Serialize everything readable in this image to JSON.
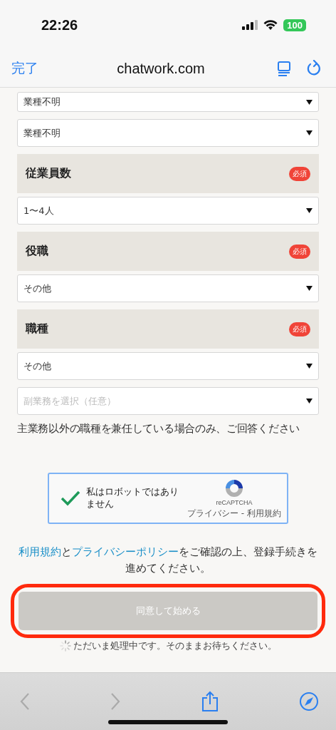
{
  "status_bar": {
    "time": "22:26",
    "battery": "100"
  },
  "browser": {
    "done": "完了",
    "url": "chatwork.com"
  },
  "fields": [
    {
      "kind": "select",
      "value": "業種不明"
    },
    {
      "kind": "select",
      "value": "業種不明"
    },
    {
      "kind": "section",
      "label": "従業員数",
      "badge": "必須"
    },
    {
      "kind": "select",
      "value": "1〜4人"
    },
    {
      "kind": "section",
      "label": "役職",
      "badge": "必須"
    },
    {
      "kind": "select",
      "value": "その他"
    },
    {
      "kind": "section",
      "label": "職種",
      "badge": "必須"
    },
    {
      "kind": "select",
      "value": "その他"
    },
    {
      "kind": "select",
      "placeholder": "副業務を選択（任意）"
    }
  ],
  "hint": "主業務以外の職種を兼任している場合のみ、ご回答ください",
  "recaptcha": {
    "checked": true,
    "label": "私はロボットではありません",
    "brand": "reCAPTCHA",
    "links": "プライバシー - 利用規約"
  },
  "terms": [
    {
      "text": "利用規約",
      "link": true
    },
    {
      "text": "と",
      "link": false
    },
    {
      "text": "プライバシーポリシー",
      "link": true
    },
    {
      "text": "をご確認の上、登録手続きを進めてください。",
      "link": false
    }
  ],
  "submit": {
    "label": "同意して始める",
    "disabled": true,
    "highlighted": true
  },
  "processing": "ただいま処理中です。そのままお待ちください。",
  "toolbar": {
    "back_disabled": true,
    "forward_disabled": true
  }
}
